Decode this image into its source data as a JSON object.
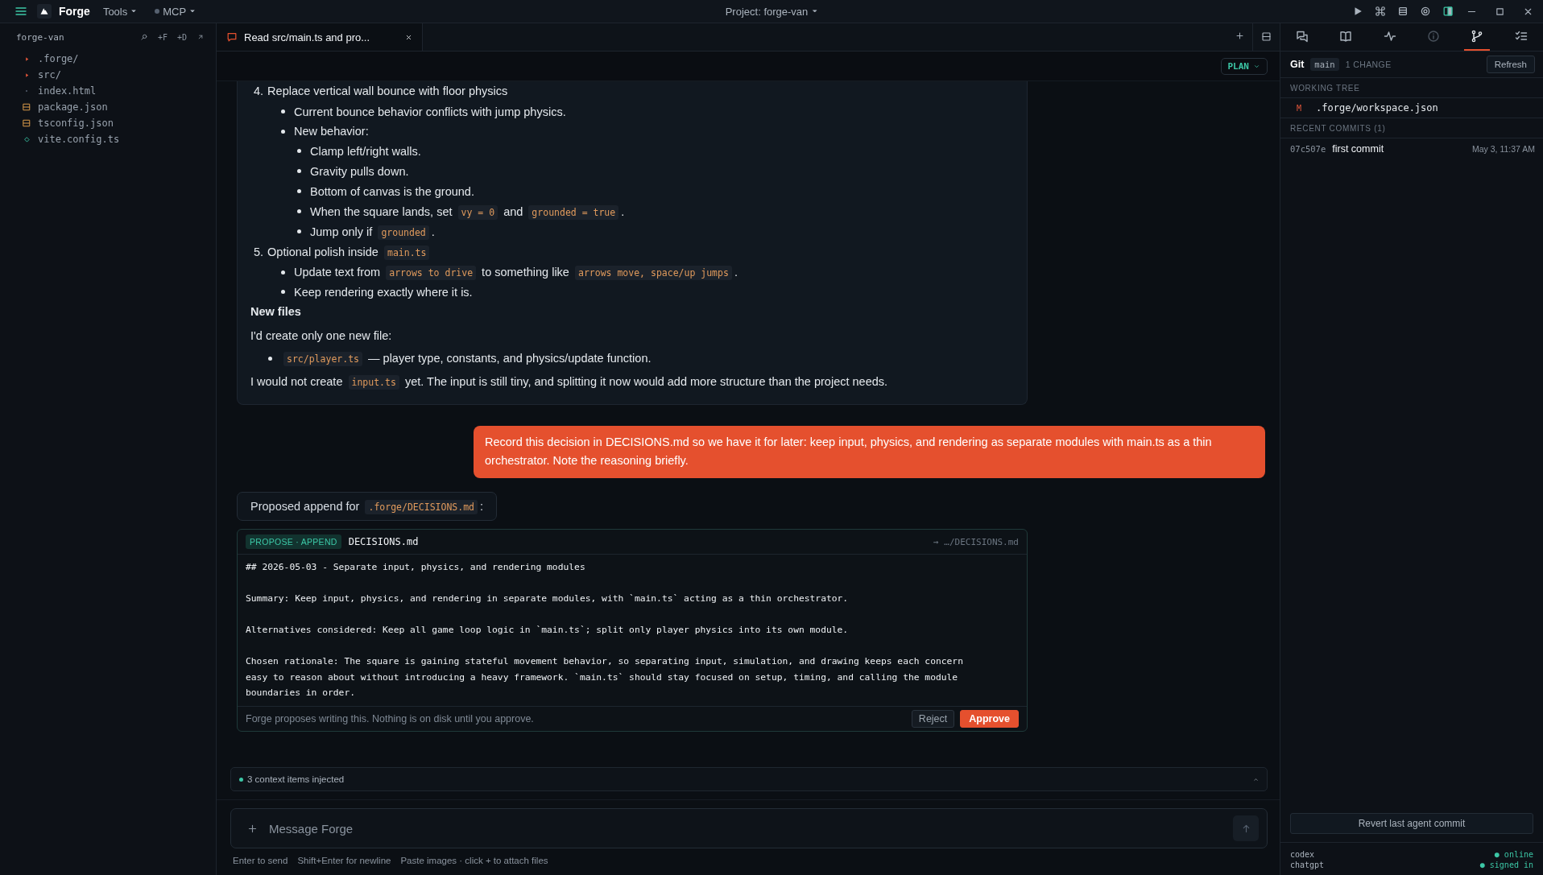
{
  "topbar": {
    "app_name": "Forge",
    "menus": [
      {
        "label": "Tools",
        "kind": "plain"
      },
      {
        "label": "MCP",
        "kind": "status"
      }
    ],
    "project": "Project: forge-van"
  },
  "sidebar": {
    "title": "forge-van",
    "actions": [
      "+F",
      "+D"
    ],
    "items": [
      {
        "name": ".forge/",
        "kind": "folder"
      },
      {
        "name": "src/",
        "kind": "folder"
      },
      {
        "name": "index.html",
        "kind": "page"
      },
      {
        "name": "package.json",
        "kind": "json"
      },
      {
        "name": "tsconfig.json",
        "kind": "json"
      },
      {
        "name": "vite.config.ts",
        "kind": "script"
      }
    ]
  },
  "tabs": [
    {
      "label": "Read src/main.ts and pro...",
      "selected": true
    }
  ],
  "mode": "PLAN",
  "assistant_message": [
    {
      "kind": "ordered",
      "number": "4.",
      "parts": [
        {
          "text": "Replace vertical wall bounce with floor physics",
          "code": false
        }
      ]
    },
    {
      "kind": "bullet",
      "parts": [
        {
          "text": "Current bounce behavior conflicts with jump physics.",
          "code": false
        }
      ]
    },
    {
      "kind": "bullet",
      "parts": [
        {
          "text": "New behavior:",
          "code": false
        }
      ]
    },
    {
      "kind": "sub-bullet",
      "parts": [
        {
          "text": "Clamp left/right walls.",
          "code": false
        }
      ]
    },
    {
      "kind": "sub-bullet",
      "parts": [
        {
          "text": "Gravity pulls down.",
          "code": false
        }
      ]
    },
    {
      "kind": "sub-bullet",
      "parts": [
        {
          "text": "Bottom of canvas is the ground.",
          "code": false
        }
      ]
    },
    {
      "kind": "sub-bullet",
      "parts": [
        {
          "text": "When the square lands, set ",
          "code": false
        },
        {
          "text": "vy = 0",
          "code": true
        },
        {
          "text": " and ",
          "code": false
        },
        {
          "text": "grounded = true",
          "code": true
        },
        {
          "text": ".",
          "code": false
        }
      ]
    },
    {
      "kind": "sub-bullet",
      "parts": [
        {
          "text": "Jump only if ",
          "code": false
        },
        {
          "text": "grounded",
          "code": true
        },
        {
          "text": ".",
          "code": false
        }
      ]
    },
    {
      "kind": "ordered",
      "number": "5.",
      "parts": [
        {
          "text": "Optional polish inside ",
          "code": false
        },
        {
          "text": "main.ts",
          "code": true
        }
      ]
    },
    {
      "kind": "bullet",
      "parts": [
        {
          "text": "Update text from ",
          "code": false
        },
        {
          "text": "arrows to drive",
          "code": true
        },
        {
          "text": " to something like ",
          "code": false
        },
        {
          "text": "arrows move, space/up jumps",
          "code": true
        },
        {
          "text": ".",
          "code": false
        }
      ]
    },
    {
      "kind": "bullet",
      "parts": [
        {
          "text": "Keep rendering exactly where it is.",
          "code": false
        }
      ]
    },
    {
      "kind": "heading",
      "parts": [
        {
          "text": "New files",
          "code": false
        }
      ]
    },
    {
      "kind": "paragraph",
      "parts": [
        {
          "text": "I'd create only one new file:",
          "code": false
        }
      ]
    },
    {
      "kind": "flat-bullet",
      "parts": [
        {
          "text": "src/player.ts",
          "code": true
        },
        {
          "text": " — player type, constants, and physics/update function.",
          "code": false
        }
      ]
    },
    {
      "kind": "paragraph",
      "parts": [
        {
          "text": "I would not create ",
          "code": false
        },
        {
          "text": "input.ts",
          "code": true
        },
        {
          "text": " yet. The input is still tiny, and splitting it now would add more structure than the project needs.",
          "code": false
        }
      ]
    }
  ],
  "user_message": "Record this decision in DECISIONS.md so we have it for later: keep input, physics, and rendering as separate modules with main.ts as a thin orchestrator. Note the reasoning briefly.",
  "proposal": {
    "intro": [
      {
        "text": "Proposed append for ",
        "code": false
      },
      {
        "text": ".forge/DECISIONS.md",
        "code": true
      },
      {
        "text": ":",
        "code": false
      }
    ],
    "badge": "PROPOSE · APPEND",
    "file": "DECISIONS.md",
    "target": "→ …/DECISIONS.md",
    "paragraphs": [
      [
        "## 2026-05-03 - Separate input, physics, and rendering modules"
      ],
      [
        "Summary: Keep input, physics, and rendering in separate modules, with `main.ts` acting as a thin orchestrator."
      ],
      [
        "Alternatives considered: Keep all game loop logic in `main.ts`; split only player physics into its own module."
      ],
      [
        "Chosen rationale: The square is gaining stateful movement behavior, so separating input, simulation, and drawing keeps each concern",
        "easy to reason about without introducing a heavy framework. `main.ts` should stay focused on setup, timing, and calling the module",
        "boundaries in order."
      ]
    ],
    "note": "Forge proposes writing this. Nothing is on disk until you approve.",
    "buttons": [
      {
        "label": "Reject",
        "kind": "secondary"
      },
      {
        "label": "Approve",
        "kind": "primary"
      }
    ]
  },
  "context": "3 context items injected",
  "composer": {
    "placeholder": "Message Forge"
  },
  "hints": [
    "Enter to send",
    "Shift+Enter for newline",
    "Paste images · click + to attach files"
  ],
  "git_panel": {
    "tabs": [
      {
        "kind": "chat",
        "selected": false
      },
      {
        "kind": "book",
        "selected": false
      },
      {
        "kind": "activity",
        "selected": false
      },
      {
        "kind": "info",
        "selected": false
      },
      {
        "kind": "branch",
        "selected": true
      },
      {
        "kind": "checklist",
        "selected": false
      }
    ],
    "title": "Git",
    "branch": "main",
    "changes": "1 CHANGE",
    "refresh": "Refresh",
    "working_tree_label": "WORKING TREE",
    "files": [
      {
        "status": "M",
        "path": ".forge/workspace.json"
      }
    ],
    "commits_label": "RECENT COMMITS (1)",
    "commits": [
      {
        "hash": "07c507e",
        "message": "first commit",
        "date": "May 3, 11:37 AM"
      }
    ],
    "revert": "Revert last agent commit",
    "accounts": [
      {
        "name": "codex",
        "status": "● online"
      },
      {
        "name": "chatgpt",
        "status": "● signed in"
      }
    ]
  }
}
